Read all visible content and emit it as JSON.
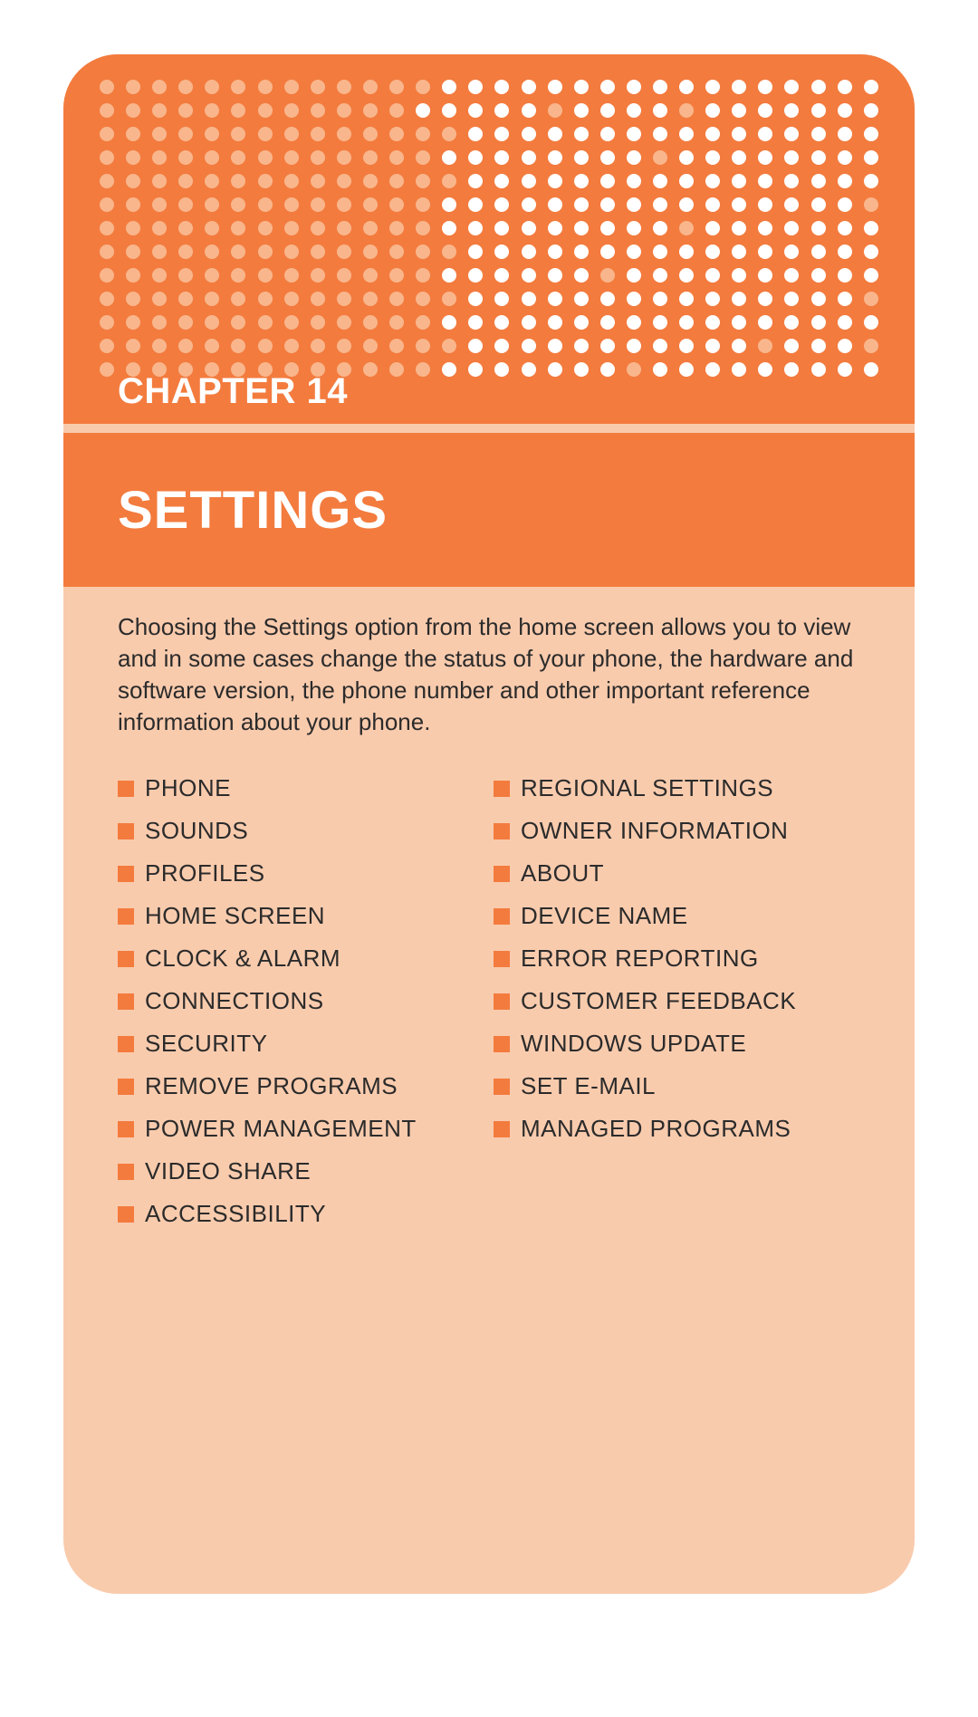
{
  "chapter": {
    "label": "CHAPTER 14",
    "title": "SETTINGS"
  },
  "intro": "Choosing the Settings option from the home screen allows you to view and in some cases change the status of your phone, the hardware and software version, the phone number and other important reference information about your phone.",
  "toc": {
    "left": [
      "PHONE",
      "SOUNDS",
      "PROFILES",
      "HOME SCREEN",
      "CLOCK & ALARM",
      "CONNECTIONS",
      "SECURITY",
      "REMOVE PROGRAMS",
      "POWER MANAGEMENT",
      "VIDEO SHARE",
      "ACCESSIBILITY"
    ],
    "right": [
      "REGIONAL SETTINGS",
      "OWNER INFORMATION",
      "ABOUT",
      "DEVICE NAME",
      "ERROR REPORTING",
      "CUSTOMER FEEDBACK",
      "WINDOWS UPDATE",
      "SET E-MAIL",
      "MANAGED PROGRAMS"
    ]
  },
  "colors": {
    "accent": "#f37b3e",
    "panel": "#f9cbad"
  }
}
